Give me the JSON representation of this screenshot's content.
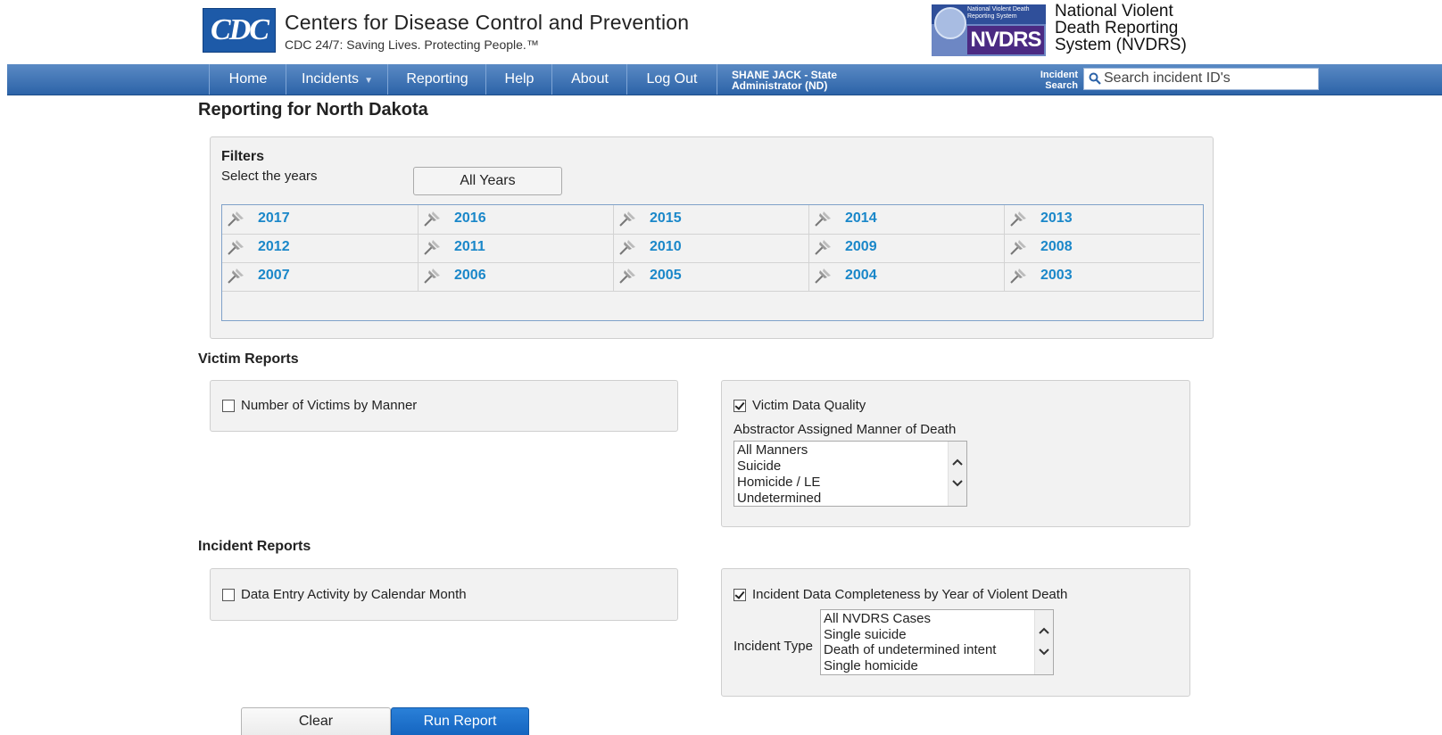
{
  "header": {
    "cdc_logo_text": "CDC",
    "cdc_title": "Centers for Disease Control and Prevention",
    "cdc_tagline": "CDC 24/7: Saving Lives. Protecting People.™",
    "nvdrs_band_text": "National Violent Death Reporting System",
    "nvdrs_logo_text": "NVDRS",
    "nvdrs_title_lines": [
      "National Violent",
      "Death Reporting",
      "System (NVDRS)"
    ]
  },
  "nav": {
    "items": [
      {
        "label": "Home"
      },
      {
        "label": "Incidents"
      },
      {
        "label": "Reporting"
      },
      {
        "label": "Help"
      },
      {
        "label": "About"
      },
      {
        "label": "Log Out"
      }
    ],
    "user_lines": [
      "SHANE JACK - State",
      "Administrator (ND)"
    ],
    "incident_search_lines": [
      "Incident",
      "Search"
    ],
    "search_placeholder": "Search incident ID's"
  },
  "page": {
    "title": "Reporting for North Dakota"
  },
  "filters": {
    "heading": "Filters",
    "select_label": "Select the years",
    "all_years_button": "All Years",
    "years": [
      [
        "2017",
        "2016",
        "2015",
        "2014",
        "2013"
      ],
      [
        "2012",
        "2011",
        "2010",
        "2009",
        "2008"
      ],
      [
        "2007",
        "2006",
        "2005",
        "2004",
        "2003"
      ]
    ]
  },
  "victim_reports": {
    "heading": "Victim Reports",
    "number_by_manner": {
      "label": "Number of Victims by Manner",
      "checked": false
    },
    "data_quality": {
      "label": "Victim Data Quality",
      "checked": true,
      "manner_label": "Abstractor Assigned Manner of Death",
      "manner_options": [
        "All Manners",
        "Suicide",
        "Homicide / LE",
        "Undetermined"
      ]
    }
  },
  "incident_reports": {
    "heading": "Incident Reports",
    "data_entry_activity": {
      "label": "Data Entry Activity by Calendar Month",
      "checked": false
    },
    "completeness": {
      "label": "Incident Data Completeness by Year of Violent Death",
      "checked": true,
      "type_label": "Incident Type",
      "type_options": [
        "All NVDRS Cases",
        "Single suicide",
        "Death of undetermined intent",
        "Single homicide"
      ]
    }
  },
  "actions": {
    "clear": "Clear",
    "run": "Run Report"
  },
  "colors": {
    "nav_blue": "#2c63a8",
    "link_blue": "#1a87c9",
    "run_button": "#1565c0",
    "nvdrs_purple": "#4b2a83"
  }
}
